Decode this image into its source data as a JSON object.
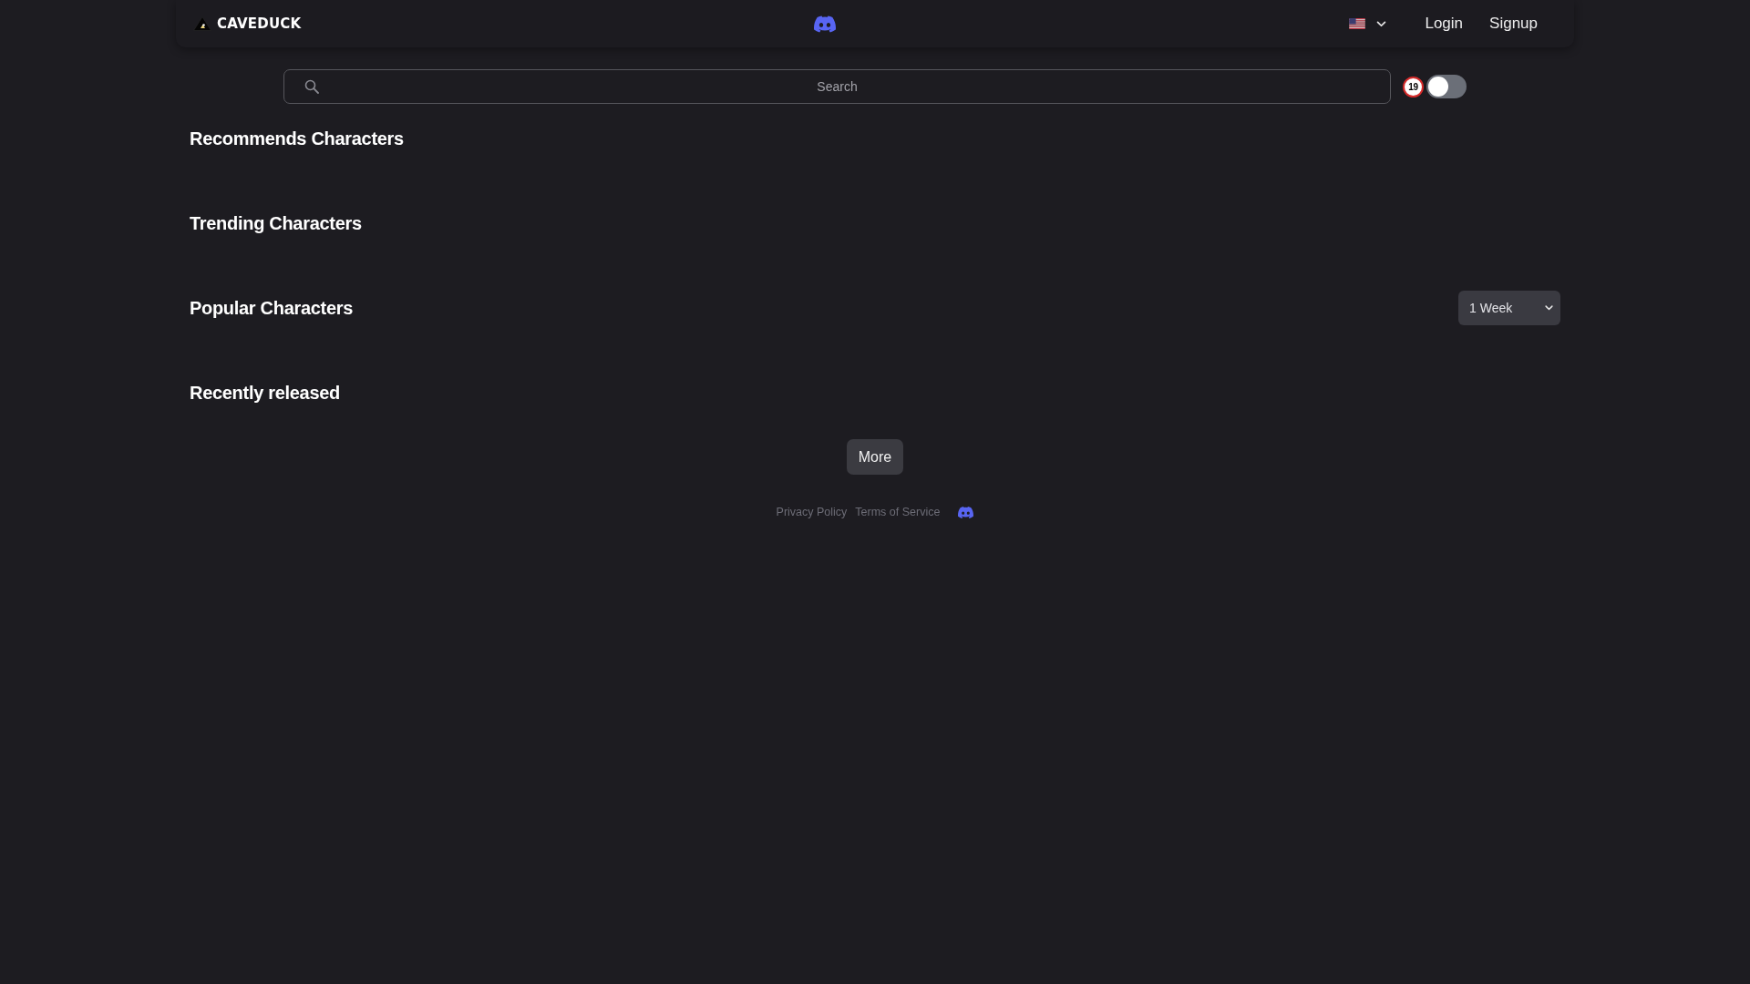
{
  "header": {
    "logo": "CAVEDUCK",
    "nav_links": [
      "Login",
      "Signup"
    ]
  },
  "search": {
    "placeholder": "Search"
  },
  "adult_filter": {
    "badge": "19",
    "on": false
  },
  "sections": [
    {
      "title": "Recommends Characters"
    },
    {
      "title": "Trending Characters"
    },
    {
      "title": "Popular Characters",
      "period_select": {
        "value": "1 Week"
      }
    },
    {
      "title": "Recently released"
    }
  ],
  "more_button": "More",
  "footer": {
    "links": [
      "Privacy Policy",
      "Terms of Service"
    ]
  }
}
